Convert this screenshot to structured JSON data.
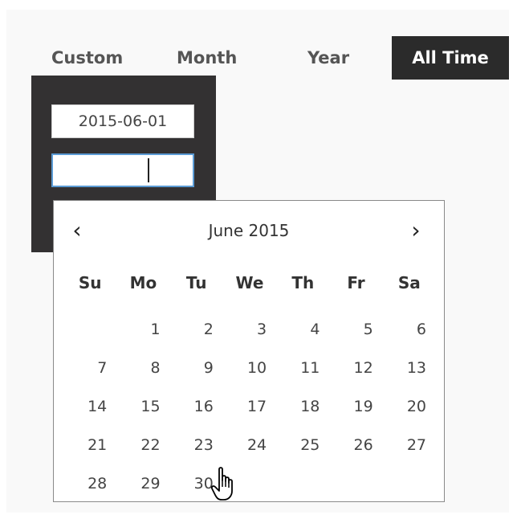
{
  "tabs": [
    {
      "label": "Custom"
    },
    {
      "label": "Month"
    },
    {
      "label": "Year"
    },
    {
      "label": "All Time",
      "active": true
    }
  ],
  "date_range": {
    "start_value": "2015-06-01",
    "end_value": ""
  },
  "datepicker": {
    "title": "June 2015",
    "prev_glyph": "‹",
    "next_glyph": "›",
    "weekdays": [
      "Su",
      "Mo",
      "Tu",
      "We",
      "Th",
      "Fr",
      "Sa"
    ],
    "weeks": [
      [
        "",
        "1",
        "2",
        "3",
        "4",
        "5",
        "6"
      ],
      [
        "7",
        "8",
        "9",
        "10",
        "11",
        "12",
        "13"
      ],
      [
        "14",
        "15",
        "16",
        "17",
        "18",
        "19",
        "20"
      ],
      [
        "21",
        "22",
        "23",
        "24",
        "25",
        "26",
        "27"
      ],
      [
        "28",
        "29",
        "30",
        "",
        "",
        "",
        ""
      ]
    ]
  },
  "colors": {
    "active_tab_bg": "#2b2b2b",
    "dark_box_bg": "#333132",
    "focus_border": "#5b9bd5"
  },
  "cursor": {
    "icon": "hand-pointer-icon"
  }
}
